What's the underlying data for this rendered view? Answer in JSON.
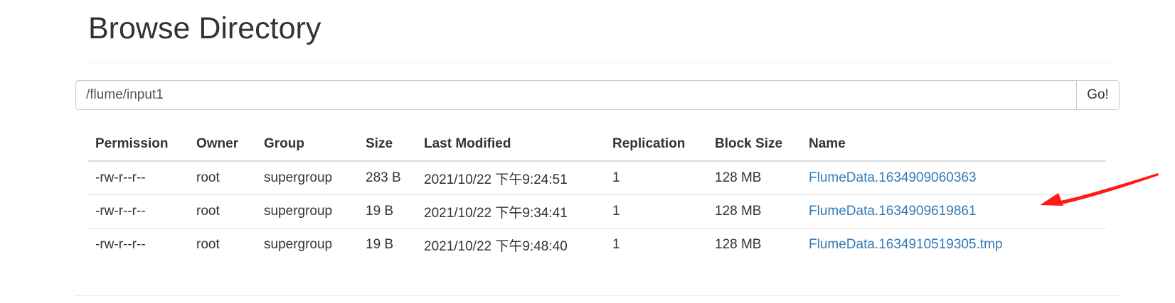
{
  "page": {
    "title": "Browse Directory"
  },
  "path_bar": {
    "value": "/flume/input1",
    "go_label": "Go!"
  },
  "table": {
    "columns": [
      "Permission",
      "Owner",
      "Group",
      "Size",
      "Last Modified",
      "Replication",
      "Block Size",
      "Name"
    ],
    "rows": [
      {
        "permission": "-rw-r--r--",
        "owner": "root",
        "group": "supergroup",
        "size": "283 B",
        "last_modified": "2021/10/22 下午9:24:51",
        "replication": "1",
        "block_size": "128 MB",
        "name": "FlumeData.1634909060363"
      },
      {
        "permission": "-rw-r--r--",
        "owner": "root",
        "group": "supergroup",
        "size": "19 B",
        "last_modified": "2021/10/22 下午9:34:41",
        "replication": "1",
        "block_size": "128 MB",
        "name": "FlumeData.1634909619861"
      },
      {
        "permission": "-rw-r--r--",
        "owner": "root",
        "group": "supergroup",
        "size": "19 B",
        "last_modified": "2021/10/22 下午9:48:40",
        "replication": "1",
        "block_size": "128 MB",
        "name": "FlumeData.1634910519305.tmp"
      }
    ]
  },
  "colors": {
    "link": "#337ab7",
    "annotation_arrow": "#ff1a1a"
  },
  "icons": {
    "annotation": "red-arrow-annotation"
  }
}
